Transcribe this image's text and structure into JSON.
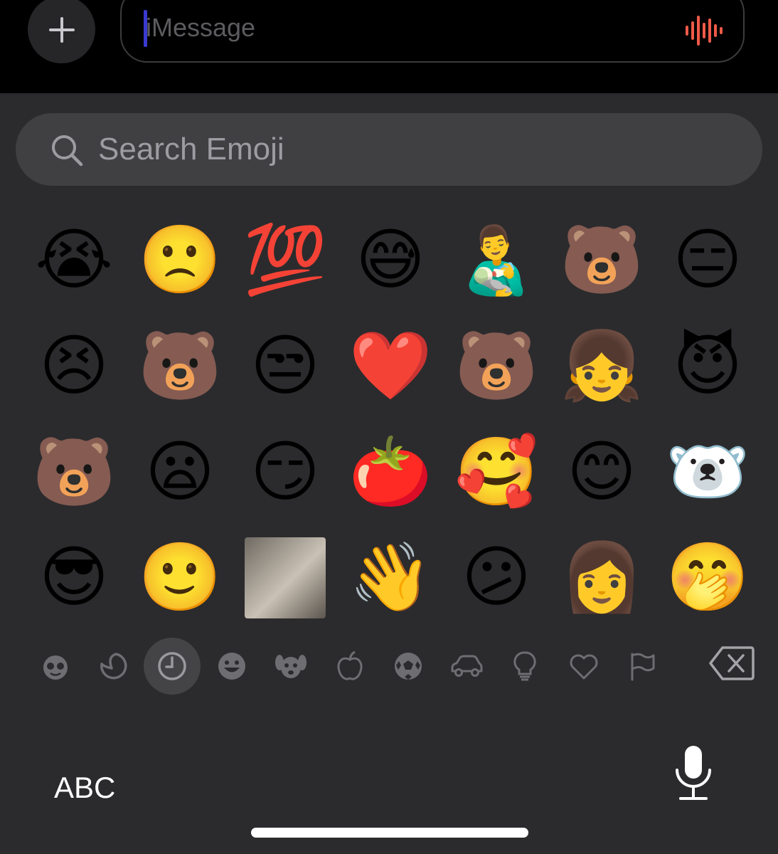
{
  "message_bar": {
    "add_icon": "plus-icon",
    "placeholder": "iMessage",
    "audio_icon": "waveform-icon",
    "audio_icon_color": "#ef5a47"
  },
  "emoji_search": {
    "icon": "magnifier-icon",
    "placeholder": "Search Emoji"
  },
  "emoji_grid": {
    "rows": [
      [
        {
          "glyph": "😭",
          "label": "loudly crying face"
        },
        {
          "glyph": "🙁",
          "label": "slightly frowning face"
        },
        {
          "glyph": "💯",
          "label": "hundred points"
        },
        {
          "glyph": "😅",
          "label": "grinning face with sweat"
        },
        {
          "glyph": "👨‍🍼",
          "label": "man feeding baby"
        },
        {
          "glyph": "🐻",
          "label": "bear sticker ok"
        },
        {
          "glyph": "😑",
          "label": "expressionless face"
        }
      ],
      [
        {
          "glyph": "😣",
          "label": "persevering face"
        },
        {
          "glyph": "🐻",
          "label": "bear sticker"
        },
        {
          "glyph": "😒",
          "label": "unamused face"
        },
        {
          "glyph": "❤️",
          "label": "red heart"
        },
        {
          "glyph": "🐻",
          "label": "bear hug sticker"
        },
        {
          "glyph": "👧",
          "label": "girl"
        },
        {
          "glyph": "😈",
          "label": "smiling face with horns"
        }
      ],
      [
        {
          "glyph": "🐻",
          "label": "crying bear sticker"
        },
        {
          "glyph": "😦",
          "label": "frowning face with open mouth"
        },
        {
          "glyph": "😏",
          "label": "smirking face"
        },
        {
          "glyph": "🍅",
          "label": "tomato"
        },
        {
          "glyph": "🥰",
          "label": "smiling face with hearts"
        },
        {
          "glyph": "😊",
          "label": "smiling face with smiling eyes"
        },
        {
          "glyph": "🐻‍❄️",
          "label": "white bear sticker"
        }
      ],
      [
        {
          "glyph": "😎",
          "label": "smiling face with sunglasses"
        },
        {
          "glyph": "🙂",
          "label": "slightly smiling face"
        },
        {
          "glyph": "",
          "label": "cat photo sticker"
        },
        {
          "glyph": "👋",
          "label": "waving hand"
        },
        {
          "glyph": "😕",
          "label": "confused face"
        },
        {
          "glyph": "👩",
          "label": "memoji sticker"
        },
        {
          "glyph": "🤭",
          "label": "face with hand over mouth"
        }
      ]
    ]
  },
  "categories": [
    {
      "icon": "memoji-icon",
      "selected": false
    },
    {
      "icon": "stickers-icon",
      "selected": false
    },
    {
      "icon": "clock-icon",
      "selected": true
    },
    {
      "icon": "smiley-icon",
      "selected": false
    },
    {
      "icon": "dog-icon",
      "selected": false
    },
    {
      "icon": "apple-icon",
      "selected": false
    },
    {
      "icon": "soccer-ball-icon",
      "selected": false
    },
    {
      "icon": "car-icon",
      "selected": false
    },
    {
      "icon": "lightbulb-icon",
      "selected": false
    },
    {
      "icon": "heart-icon",
      "selected": false
    },
    {
      "icon": "flag-icon",
      "selected": false
    }
  ],
  "keyboard": {
    "abc_label": "ABC",
    "delete_icon": "delete-backward-icon",
    "dictation_icon": "microphone-icon"
  },
  "colors": {
    "background": "#2b2b2d",
    "top_bar": "#000000",
    "search_bg": "#404043",
    "icon_gray": "#6e6e72"
  }
}
